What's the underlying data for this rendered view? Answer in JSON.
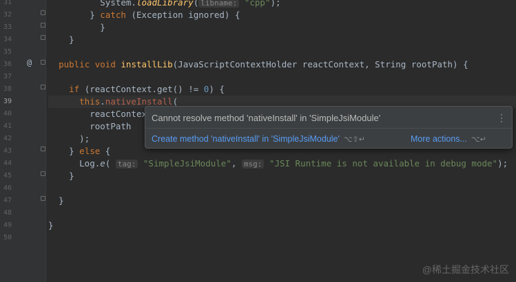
{
  "editor": {
    "current_line": "39",
    "override_marker": "@",
    "line_numbers": [
      "31",
      "32",
      "33",
      "34",
      "35",
      "36",
      "37",
      "38",
      "39",
      "40",
      "41",
      "42",
      "43",
      "44",
      "45",
      "46",
      "47",
      "48",
      "49",
      "50"
    ],
    "code": {
      "l31_a": "System.",
      "l31_b": "loadLibrary",
      "l31_c": "(",
      "l31_hint": "libname:",
      "l31_d": "\"cpp\"",
      "l31_e": ");",
      "l32_a": "} ",
      "l32_kw": "catch",
      "l32_b": " (Exception ignored) {",
      "l33": "}",
      "l34": "}",
      "l36_kw1": "public",
      "l36_kw2": "void",
      "l36_fn": "installLib",
      "l36_rest": "(JavaScriptContextHolder reactContext, String rootPath) {",
      "l38_kw": "if",
      "l38_a": " (reactContext.get() != ",
      "l38_num": "0",
      "l38_b": ") {",
      "l39_kw": "this",
      "l39_dot": ".",
      "l39_method": "nativeInstall",
      "l39_paren": "(",
      "l40": "reactContext",
      "l41": "rootPath",
      "l42": ");",
      "l43_a": "} ",
      "l43_kw": "else",
      "l43_b": " {",
      "l44_a": "Log.",
      "l44_fn": "e",
      "l44_paren": "(",
      "l44_hint1": "tag:",
      "l44_str1": "\"SimpleJsiModule\"",
      "l44_comma": ", ",
      "l44_hint2": "msg:",
      "l44_str2": "\"JSI Runtime is not available in debug mode\"",
      "l44_end": ");",
      "l45": "}",
      "l47": "}",
      "l49": "}"
    }
  },
  "popup": {
    "title": "Cannot resolve method 'nativeInstall' in 'SimpleJsiModule'",
    "menu_icon": "⋮",
    "action_label": "Create method 'nativeInstall' in 'SimpleJsiModule'",
    "action_shortcut": "⌥⇧↵",
    "more_label": "More actions...",
    "more_shortcut": "⌥↵"
  },
  "watermark": "@稀土掘金技术社区",
  "colors": {
    "background": "#2b2b2b",
    "keyword": "#cc7832",
    "string": "#6a8759",
    "link": "#589df6",
    "error": "#b5624d"
  }
}
